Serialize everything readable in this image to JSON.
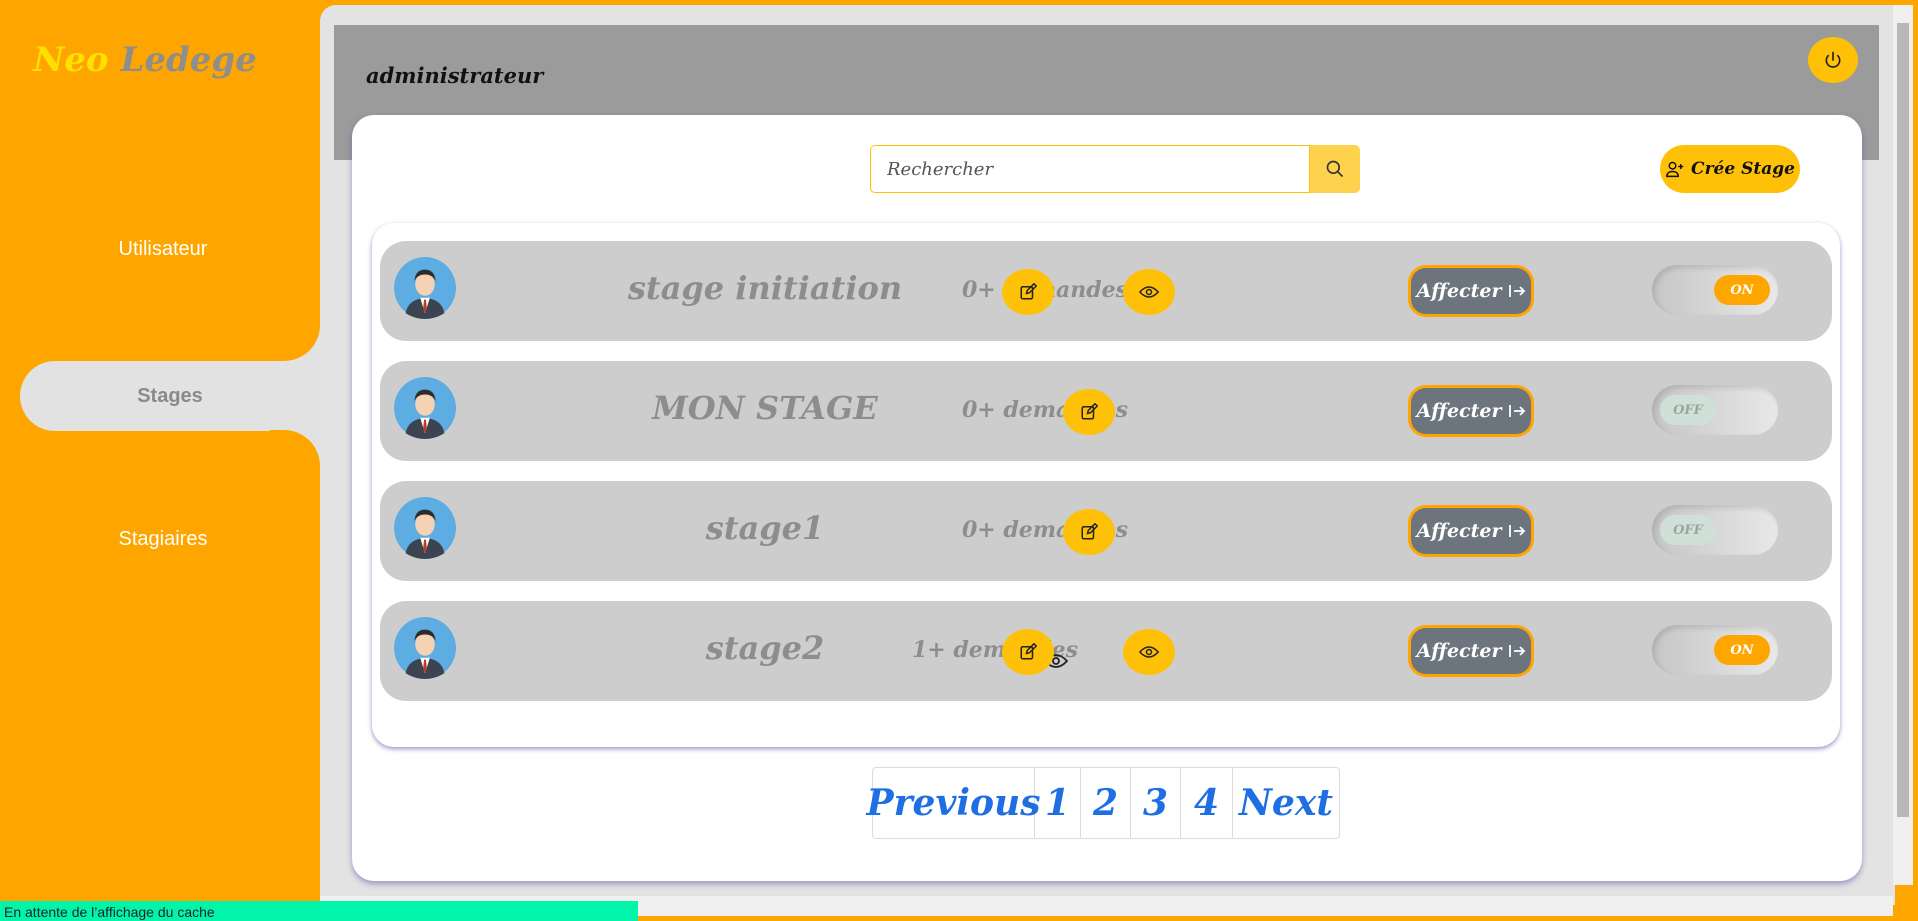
{
  "brand": {
    "part1": "Neo",
    "part2": "Ledege"
  },
  "sidebar": {
    "items": [
      {
        "label": "Utilisateur",
        "active": false
      },
      {
        "label": "Stages",
        "active": true
      },
      {
        "label": "Stagiaires",
        "active": false
      }
    ]
  },
  "header": {
    "user": "administrateur",
    "power_icon": "power-icon"
  },
  "search": {
    "placeholder": "Rechercher",
    "icon": "search-icon"
  },
  "create_button": {
    "label": "Crée Stage",
    "icon": "user-plus-icon"
  },
  "stages": [
    {
      "title": "stage initiation",
      "count": "0+ demandes",
      "count_eye": false,
      "view_button": true,
      "affecter": "Affecter",
      "toggle": "ON"
    },
    {
      "title": "MON STAGE",
      "count": "0+ demandes",
      "count_eye": false,
      "view_button": false,
      "affecter": "Affecter",
      "toggle": "OFF"
    },
    {
      "title": "stage1",
      "count": "0+ demandes",
      "count_eye": false,
      "view_button": false,
      "affecter": "Affecter",
      "toggle": "OFF"
    },
    {
      "title": "stage2",
      "count": "1+ demandes",
      "count_eye": true,
      "view_button": true,
      "affecter": "Affecter",
      "toggle": "ON"
    }
  ],
  "pagination": {
    "previous": "Previous",
    "pages": [
      "1",
      "2",
      "3",
      "4"
    ],
    "next": "Next"
  },
  "status_bar": "En attente de l’affichage du cache",
  "colors": {
    "accent": "#FFA500",
    "button_yellow": "#FFC107",
    "header_gray": "#9B9B9B",
    "row_gray": "#CDCDCD",
    "link_blue": "#1E6FE3"
  }
}
